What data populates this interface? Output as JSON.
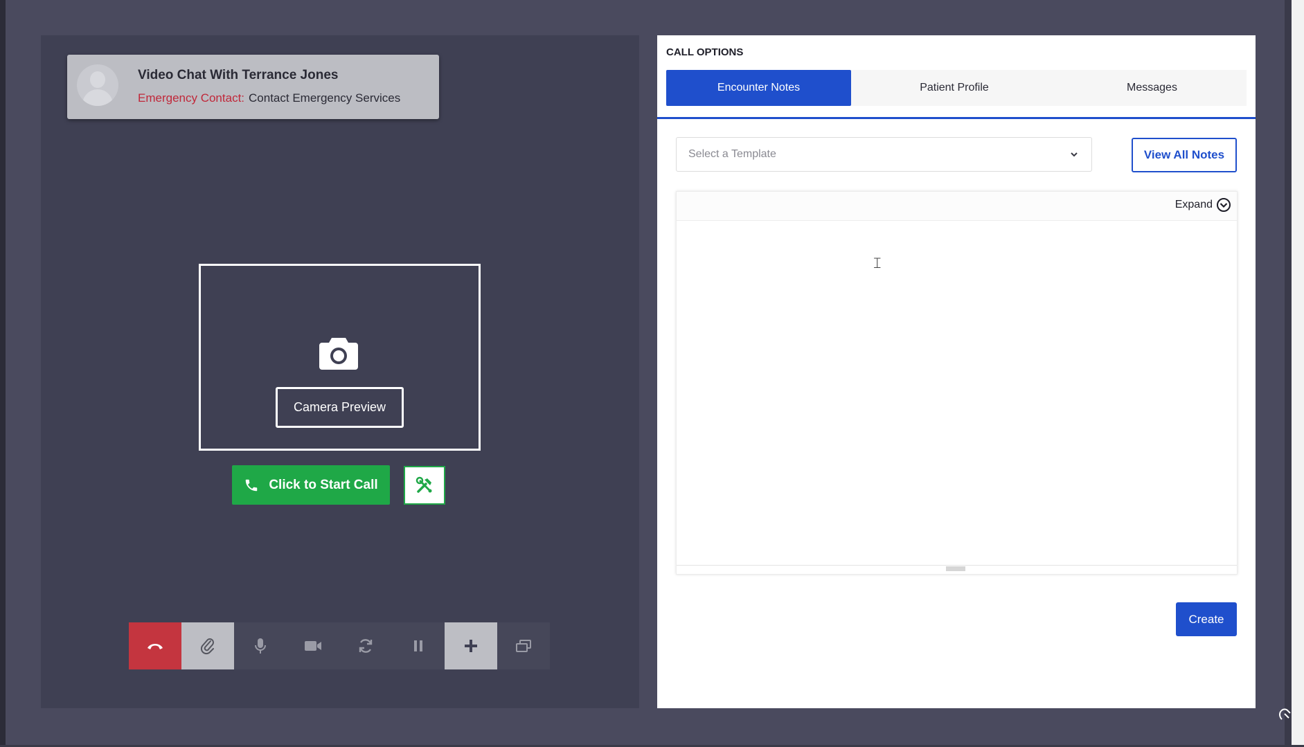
{
  "caller": {
    "title": "Video Chat With Terrance Jones",
    "emergency_label": "Emergency Contact:",
    "emergency_value": "Contact Emergency Services"
  },
  "preview": {
    "label": "Camera Preview"
  },
  "call": {
    "start_label": "Click to Start Call"
  },
  "controls": [
    {
      "icon": "end-call-icon"
    },
    {
      "icon": "paperclip-icon"
    },
    {
      "icon": "microphone-icon"
    },
    {
      "icon": "video-camera-icon"
    },
    {
      "icon": "refresh-icon"
    },
    {
      "icon": "pause-icon"
    },
    {
      "icon": "plus-icon"
    },
    {
      "icon": "picture-in-picture-icon"
    }
  ],
  "options": {
    "title": "CALL OPTIONS",
    "tabs": [
      {
        "label": "Encounter Notes",
        "active": true
      },
      {
        "label": "Patient Profile",
        "active": false
      },
      {
        "label": "Messages",
        "active": false
      }
    ],
    "template_placeholder": "Select a Template",
    "view_all_label": "View All Notes",
    "expand_label": "Expand",
    "create_label": "Create"
  },
  "colors": {
    "accent": "#1f4fcc",
    "start_call": "#1fa847",
    "end_call": "#c4353f",
    "emergency": "#c0283a",
    "panel_bg": "#3f4053"
  }
}
